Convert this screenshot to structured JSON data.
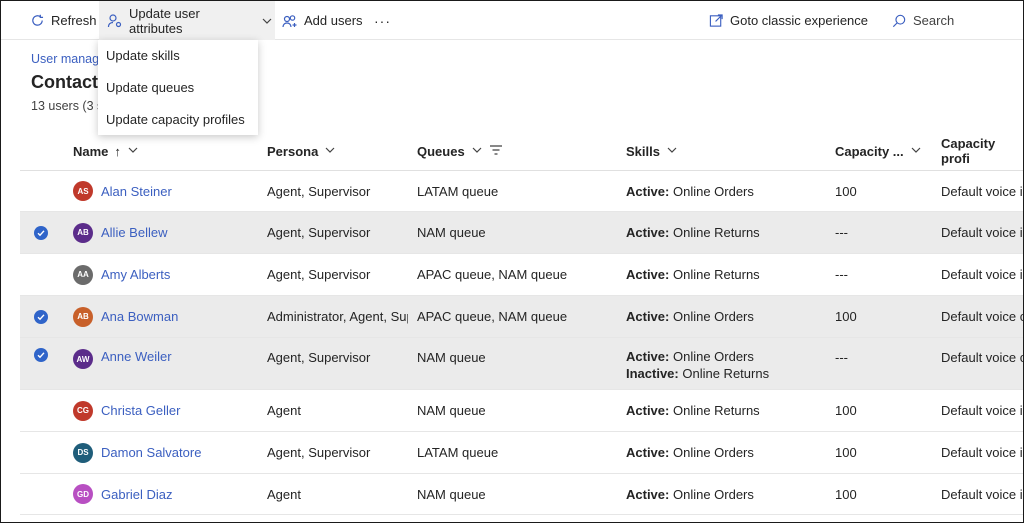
{
  "toolbar": {
    "refresh": "Refresh",
    "update_attrs": "Update user attributes",
    "add_users": "Add users",
    "more": "···",
    "classic": "Goto classic experience",
    "search": "Search"
  },
  "dropdown": {
    "items": [
      "Update skills",
      "Update queues",
      "Update capacity profiles"
    ]
  },
  "page": {
    "breadcrumb": "User manage",
    "title": "Contact",
    "count": "13 users (3 s"
  },
  "table": {
    "columns": {
      "name": "Name",
      "persona": "Persona",
      "queues": "Queues",
      "skills": "Skills",
      "capacity": "Capacity ...",
      "profile": "Capacity profi"
    },
    "rows": [
      {
        "initials": "AS",
        "avatar_color": "#c0392b",
        "name": "Alan Steiner",
        "persona": "Agent, Supervisor",
        "queues": "LATAM queue",
        "skills": [
          {
            "state": "Active:",
            "value": "Online Orders"
          }
        ],
        "capacity": "100",
        "profile": "Default voice i",
        "selected": false
      },
      {
        "initials": "AB",
        "avatar_color": "#5b2c8a",
        "name": "Allie Bellew",
        "persona": "Agent, Supervisor",
        "queues": "NAM queue",
        "skills": [
          {
            "state": "Active:",
            "value": "Online Returns"
          }
        ],
        "capacity": "---",
        "profile": "Default voice i",
        "selected": true
      },
      {
        "initials": "AA",
        "avatar_color": "#6b6b6b",
        "name": "Amy Alberts",
        "persona": "Agent, Supervisor",
        "queues": "APAC queue, NAM queue",
        "skills": [
          {
            "state": "Active:",
            "value": "Online Returns"
          }
        ],
        "capacity": "---",
        "profile": "Default voice i",
        "selected": false
      },
      {
        "initials": "AB",
        "avatar_color": "#c8602a",
        "name": "Ana Bowman",
        "persona": "Administrator, Agent, Sup",
        "queues": "APAC queue, NAM queue",
        "skills": [
          {
            "state": "Active:",
            "value": "Online Orders"
          }
        ],
        "capacity": "100",
        "profile": "Default voice c",
        "selected": true
      },
      {
        "initials": "AW",
        "avatar_color": "#5b2c8a",
        "name": "Anne Weiler",
        "persona": "Agent, Supervisor",
        "queues": "NAM queue",
        "skills": [
          {
            "state": "Active:",
            "value": "Online Orders"
          },
          {
            "state": "Inactive:",
            "value": "Online Returns"
          }
        ],
        "capacity": "---",
        "profile": "Default voice c",
        "selected": true
      },
      {
        "initials": "CG",
        "avatar_color": "#c0392b",
        "name": "Christa Geller",
        "persona": "Agent",
        "queues": "NAM queue",
        "skills": [
          {
            "state": "Active:",
            "value": "Online Returns"
          }
        ],
        "capacity": "100",
        "profile": "Default voice i",
        "selected": false
      },
      {
        "initials": "DS",
        "avatar_color": "#1f5d7a",
        "name": "Damon Salvatore",
        "persona": "Agent, Supervisor",
        "queues": "LATAM queue",
        "skills": [
          {
            "state": "Active:",
            "value": "Online Orders"
          }
        ],
        "capacity": "100",
        "profile": "Default voice i",
        "selected": false
      },
      {
        "initials": "GD",
        "avatar_color": "#b84fc2",
        "name": "Gabriel Diaz",
        "persona": "Agent",
        "queues": "NAM queue",
        "skills": [
          {
            "state": "Active:",
            "value": "Online Orders"
          }
        ],
        "capacity": "100",
        "profile": "Default voice i",
        "selected": false
      }
    ]
  },
  "colors": {
    "link": "#3b5fc0",
    "check": "#2f64c9",
    "selected_row": "#ebebeb"
  }
}
